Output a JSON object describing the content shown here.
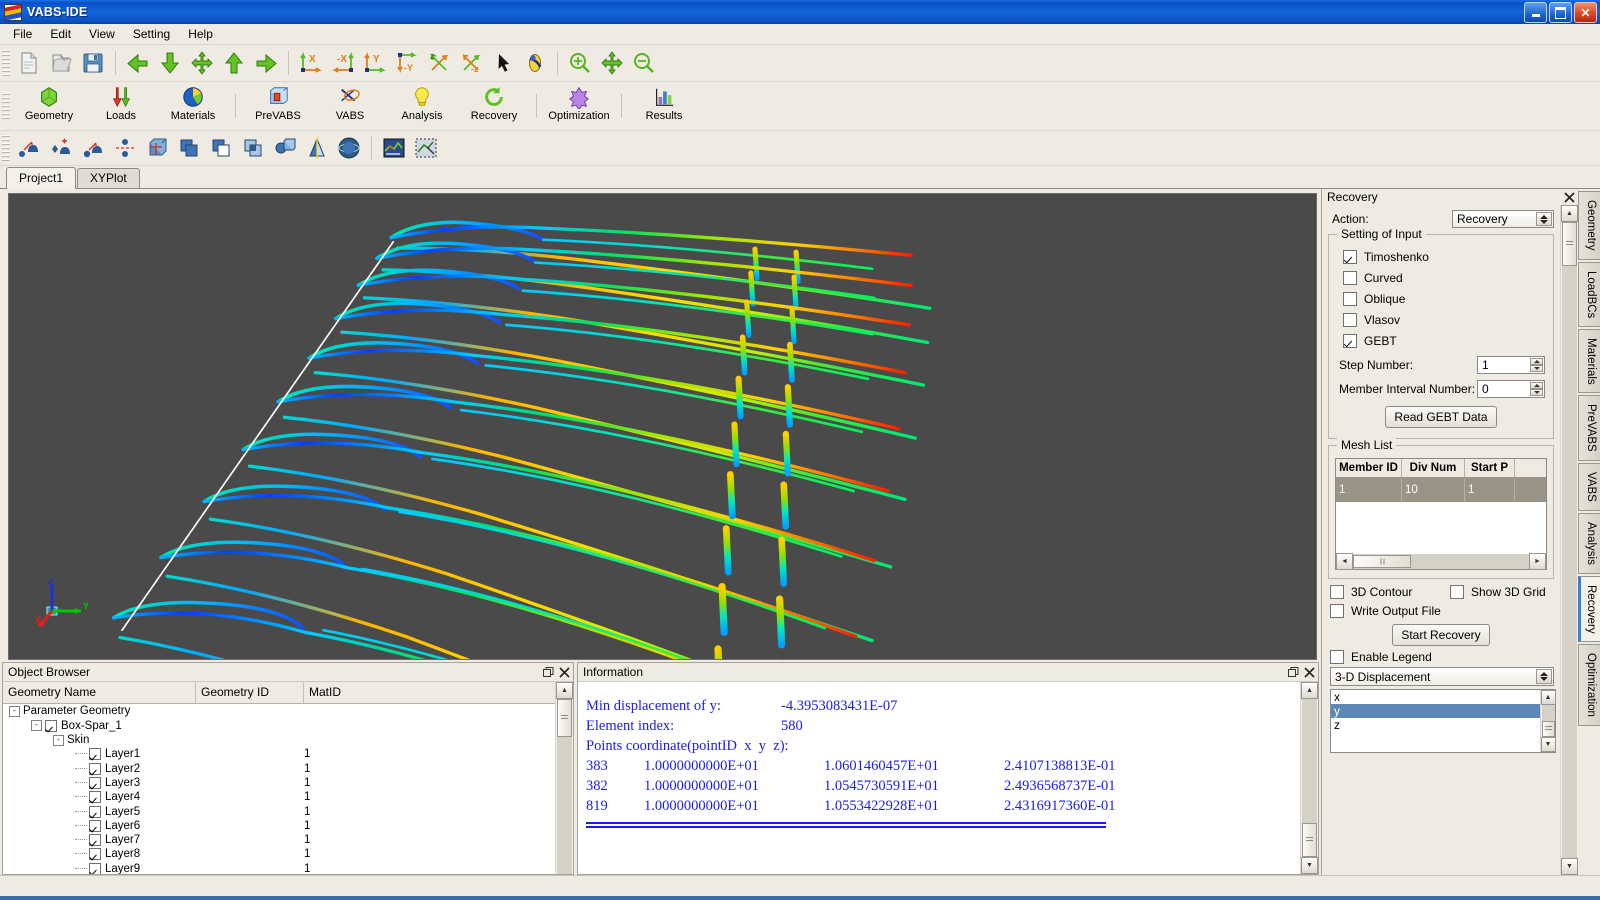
{
  "window": {
    "title": "VABS-IDE",
    "icon": "vabs-logo-icon",
    "minimize": "minimize",
    "maximize": "restore",
    "close": "close"
  },
  "menubar": {
    "items": [
      "File",
      "Edit",
      "View",
      "Setting",
      "Help"
    ]
  },
  "toolbar_file": {
    "buttons": [
      {
        "name": "new-file-icon",
        "label": "New"
      },
      {
        "name": "open-file-icon",
        "label": "Open"
      },
      {
        "name": "save-file-icon",
        "label": "Save"
      }
    ]
  },
  "toolbar_nav": {
    "buttons": [
      {
        "name": "arrow-left-icon",
        "label": "Previous"
      },
      {
        "name": "arrow-down-icon",
        "label": "Down"
      },
      {
        "name": "fit-all-icon",
        "label": "Fit All"
      },
      {
        "name": "arrow-up-icon",
        "label": "Up"
      },
      {
        "name": "arrow-right-icon",
        "label": "Next"
      }
    ]
  },
  "toolbar_views": {
    "buttons": [
      {
        "name": "view-x-icon",
        "label": "X View"
      },
      {
        "name": "view-minus-x-icon",
        "label": "-X View"
      },
      {
        "name": "view-y-icon",
        "label": "Y View"
      },
      {
        "name": "view-minus-y-icon",
        "label": "-Y View"
      },
      {
        "name": "view-z-icon",
        "label": "Z View"
      },
      {
        "name": "view-minus-z-icon",
        "label": "-Z View"
      },
      {
        "name": "select-cursor-icon",
        "label": "Select"
      },
      {
        "name": "rotate-icon",
        "label": "Rotate"
      }
    ]
  },
  "toolbar_zoom": {
    "buttons": [
      {
        "name": "zoom-in-icon",
        "label": "Zoom In"
      },
      {
        "name": "pan-icon",
        "label": "Pan"
      },
      {
        "name": "zoom-out-icon",
        "label": "Zoom Out"
      }
    ]
  },
  "toolbar_modules": {
    "buttons": [
      {
        "name": "geometry-icon",
        "label": "Geometry"
      },
      {
        "name": "loads-icon",
        "label": "Loads"
      },
      {
        "name": "materials-icon",
        "label": "Materials"
      },
      {
        "name": "prevabs-icon",
        "label": "PreVABS"
      },
      {
        "name": "vabs-icon",
        "label": "VABS"
      },
      {
        "name": "analysis-icon",
        "label": "Analysis"
      },
      {
        "name": "recovery-icon",
        "label": "Recovery"
      },
      {
        "name": "optimization-icon",
        "label": "Optimization"
      },
      {
        "name": "results-icon",
        "label": "Results"
      }
    ]
  },
  "toolbar_geometry": {
    "buttons": [
      {
        "name": "create-point-icon",
        "label": "Create Point"
      },
      {
        "name": "add-point-icon",
        "label": "Add Point"
      },
      {
        "name": "move-point-icon",
        "label": "Move Point"
      },
      {
        "name": "split-point-icon",
        "label": "Split"
      },
      {
        "name": "create-box-icon",
        "label": "Create Box"
      },
      {
        "name": "union-icon",
        "label": "Union"
      },
      {
        "name": "subtract-icon",
        "label": "Subtract"
      },
      {
        "name": "intersect-icon",
        "label": "Intersect"
      },
      {
        "name": "cut-solid-icon",
        "label": "Cut"
      },
      {
        "name": "mirror-icon",
        "label": "Mirror"
      },
      {
        "name": "sphere-icon",
        "label": "Sphere"
      },
      {
        "name": "mesh-view-icon",
        "label": "Mesh View"
      },
      {
        "name": "select-region-icon",
        "label": "Select Region"
      }
    ]
  },
  "tabs": {
    "items": [
      {
        "label": "Project1",
        "active": true
      },
      {
        "label": "XYPlot",
        "active": false
      }
    ]
  },
  "viewport": {
    "background_color": "#4a4a4a",
    "axis": {
      "x": "X",
      "y": "Y",
      "z": "Z",
      "x_color": "#e02020",
      "y_color": "#00c800",
      "z_color": "#2030d8"
    },
    "model": "deformed-wing-cross-sections",
    "section_count": 11,
    "contour": "3-D Displacement y"
  },
  "object_browser": {
    "title": "Object Browser",
    "float_button": "float",
    "close_button": "close",
    "columns": [
      "Geometry Name",
      "Geometry ID",
      "MatID"
    ],
    "rows": [
      {
        "indent": 0,
        "expander": "-",
        "checkbox": null,
        "label": "Parameter Geometry",
        "geom_id": "",
        "mat_id": ""
      },
      {
        "indent": 1,
        "expander": "-",
        "checkbox": true,
        "label": "Box-Spar_1",
        "geom_id": "",
        "mat_id": ""
      },
      {
        "indent": 2,
        "expander": "-",
        "checkbox": null,
        "label": "Skin",
        "geom_id": "",
        "mat_id": ""
      },
      {
        "indent": 3,
        "expander": null,
        "checkbox": true,
        "label": "Layer1",
        "geom_id": "",
        "mat_id": "1"
      },
      {
        "indent": 3,
        "expander": null,
        "checkbox": true,
        "label": "Layer2",
        "geom_id": "",
        "mat_id": "1"
      },
      {
        "indent": 3,
        "expander": null,
        "checkbox": true,
        "label": "Layer3",
        "geom_id": "",
        "mat_id": "1"
      },
      {
        "indent": 3,
        "expander": null,
        "checkbox": true,
        "label": "Layer4",
        "geom_id": "",
        "mat_id": "1"
      },
      {
        "indent": 3,
        "expander": null,
        "checkbox": true,
        "label": "Layer5",
        "geom_id": "",
        "mat_id": "1"
      },
      {
        "indent": 3,
        "expander": null,
        "checkbox": true,
        "label": "Layer6",
        "geom_id": "",
        "mat_id": "1"
      },
      {
        "indent": 3,
        "expander": null,
        "checkbox": true,
        "label": "Layer7",
        "geom_id": "",
        "mat_id": "1"
      },
      {
        "indent": 3,
        "expander": null,
        "checkbox": true,
        "label": "Layer8",
        "geom_id": "",
        "mat_id": "1"
      },
      {
        "indent": 3,
        "expander": null,
        "checkbox": true,
        "label": "Layer9",
        "geom_id": "",
        "mat_id": "1"
      }
    ]
  },
  "information": {
    "title": "Information",
    "float_button": "float",
    "close_button": "close",
    "lines": [
      {
        "label": "Min displacement of y:",
        "value": "-4.3953083431E-07"
      },
      {
        "label": "Element index:",
        "value": "580"
      }
    ],
    "points_header": "Points coordinate(pointID  x  y  z):",
    "points": [
      {
        "id": "383",
        "x": "1.0000000000E+01",
        "y": "1.0601460457E+01",
        "z": "2.4107138813E-01"
      },
      {
        "id": "382",
        "x": "1.0000000000E+01",
        "y": "1.0545730591E+01",
        "z": "2.4936568737E-01"
      },
      {
        "id": "819",
        "x": "1.0000000000E+01",
        "y": "1.0553422928E+01",
        "z": "2.4316917360E-01"
      }
    ],
    "text_color": "#1a1aee"
  },
  "recovery_panel": {
    "title": "Recovery",
    "close_button": "close",
    "action_label": "Action:",
    "action_value": "Recovery",
    "setting_group_title": "Setting of Input",
    "checkboxes": [
      {
        "label": "Timoshenko",
        "checked": true
      },
      {
        "label": "Curved",
        "checked": false
      },
      {
        "label": "Oblique",
        "checked": false
      },
      {
        "label": "Vlasov",
        "checked": false
      },
      {
        "label": "GEBT",
        "checked": true
      }
    ],
    "step_number_label": "Step Number:",
    "step_number_value": "1",
    "member_interval_label": "Member Interval Number:",
    "member_interval_value": "0",
    "read_gebt_button": "Read GEBT Data",
    "mesh_list_title": "Mesh List",
    "mesh_columns": [
      "Member ID",
      "Div Num",
      "Start P"
    ],
    "mesh_rows": [
      {
        "member_id": "1",
        "div_num": "10",
        "start_p": "1"
      }
    ],
    "options": [
      {
        "label": "3D Contour",
        "checked": false
      },
      {
        "label": "Show 3D Grid",
        "checked": false
      },
      {
        "label": "Write Output File",
        "checked": false
      }
    ],
    "start_recovery_button": "Start Recovery",
    "enable_legend": {
      "label": "Enable Legend",
      "checked": false
    },
    "result_type_value": "3-D Displacement",
    "components": [
      {
        "label": "x",
        "selected": false
      },
      {
        "label": "y",
        "selected": true
      },
      {
        "label": "z",
        "selected": false
      }
    ],
    "selection_color": "#5d87b5"
  },
  "right_rail": {
    "tabs": [
      {
        "label": "Geometry",
        "active": false
      },
      {
        "label": "LoadBCs",
        "active": false
      },
      {
        "label": "Materials",
        "active": false
      },
      {
        "label": "PreVABS",
        "active": false
      },
      {
        "label": "VABS",
        "active": false
      },
      {
        "label": "Analysis",
        "active": false
      },
      {
        "label": "Recovery",
        "active": true
      },
      {
        "label": "Optimization",
        "active": false
      }
    ]
  },
  "statusbar": {
    "text": ""
  }
}
